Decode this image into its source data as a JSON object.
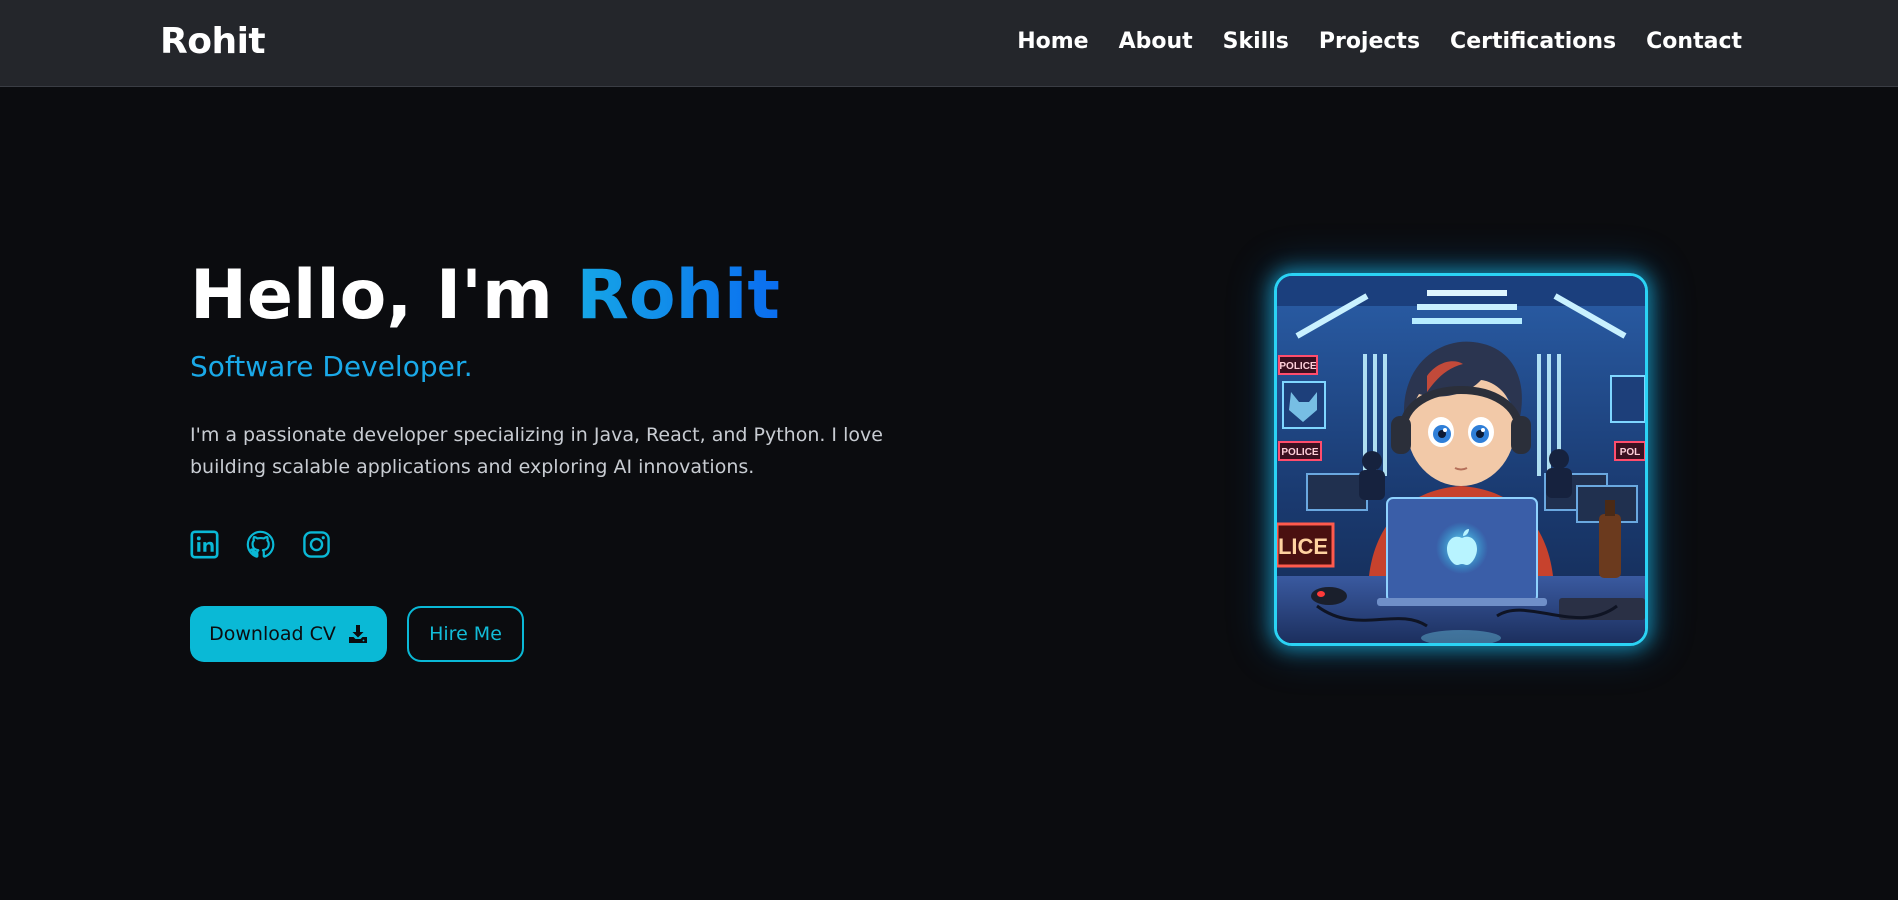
{
  "navbar": {
    "brand": "Rohit",
    "links": [
      {
        "label": "Home"
      },
      {
        "label": "About"
      },
      {
        "label": "Skills"
      },
      {
        "label": "Projects"
      },
      {
        "label": "Certifications"
      },
      {
        "label": "Contact"
      }
    ]
  },
  "hero": {
    "greeting": "Hello, I'm",
    "name": "Rohit",
    "role": "Software Developer.",
    "description": "I'm a passionate developer specializing in Java, React, and Python. I love building scalable applications and exploring AI innovations.",
    "socials": [
      {
        "icon": "linkedin-icon"
      },
      {
        "icon": "github-icon"
      },
      {
        "icon": "instagram-icon"
      }
    ],
    "buttons": {
      "download_label": "Download CV",
      "hire_label": "Hire Me"
    }
  },
  "avatar": {
    "sign_texts": [
      "POLICE",
      "POLICE",
      "POL",
      "LICE"
    ]
  },
  "colors": {
    "background": "#0b0c0f",
    "navbar": "#24262b",
    "accent": "#0ab9d6",
    "name_gradient_start": "#16a6e6",
    "name_gradient_end": "#0a6df0",
    "glow": "#2bd3f5"
  }
}
